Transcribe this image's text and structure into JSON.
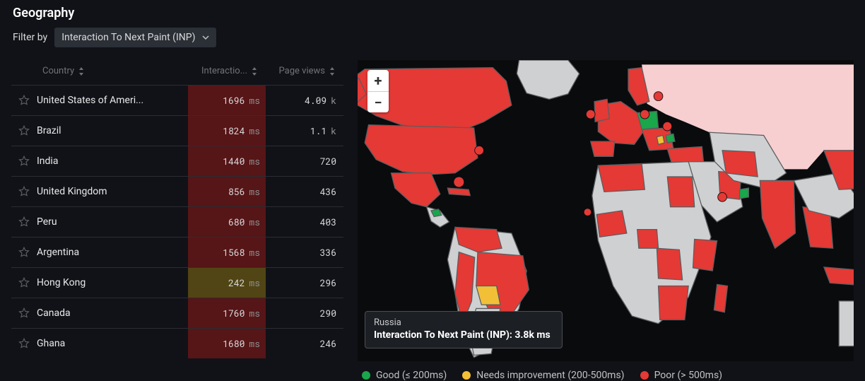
{
  "title": "Geography",
  "filter": {
    "label": "Filter by",
    "selected": "Interaction To Next Paint (INP)"
  },
  "columns": {
    "country": "Country",
    "metric": "Interactio...",
    "views": "Page views"
  },
  "rows": [
    {
      "country": "United States of Ameri...",
      "metric_value": "1696",
      "metric_unit": "ms",
      "views_value": "4.09",
      "views_unit": "k",
      "status": "poor"
    },
    {
      "country": "Brazil",
      "metric_value": "1824",
      "metric_unit": "ms",
      "views_value": "1.1",
      "views_unit": "k",
      "status": "poor"
    },
    {
      "country": "India",
      "metric_value": "1440",
      "metric_unit": "ms",
      "views_value": "720",
      "views_unit": "",
      "status": "poor"
    },
    {
      "country": "United Kingdom",
      "metric_value": "856",
      "metric_unit": "ms",
      "views_value": "436",
      "views_unit": "",
      "status": "poor"
    },
    {
      "country": "Peru",
      "metric_value": "680",
      "metric_unit": "ms",
      "views_value": "403",
      "views_unit": "",
      "status": "poor"
    },
    {
      "country": "Argentina",
      "metric_value": "1568",
      "metric_unit": "ms",
      "views_value": "336",
      "views_unit": "",
      "status": "poor"
    },
    {
      "country": "Hong Kong",
      "metric_value": "242",
      "metric_unit": "ms",
      "views_value": "296",
      "views_unit": "",
      "status": "warn"
    },
    {
      "country": "Canada",
      "metric_value": "1760",
      "metric_unit": "ms",
      "views_value": "290",
      "views_unit": "",
      "status": "poor"
    },
    {
      "country": "Ghana",
      "metric_value": "1680",
      "metric_unit": "ms",
      "views_value": "246",
      "views_unit": "",
      "status": "poor"
    }
  ],
  "map": {
    "tooltip": {
      "country": "Russia",
      "metric_label": "Interaction To Next Paint (INP):",
      "metric_value": "3.8k ms"
    },
    "zoom_in": "+",
    "zoom_out": "−"
  },
  "legend": {
    "good": "Good (≤ 200ms)",
    "warn": "Needs improvement (200-500ms)",
    "poor": "Poor (> 500ms)"
  }
}
